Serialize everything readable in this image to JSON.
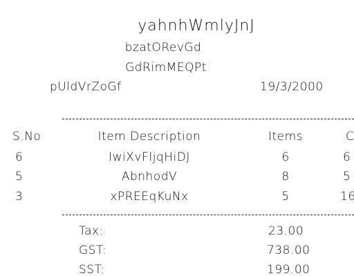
{
  "header": {
    "store_name": "yahnhWmlyJnJ",
    "line1": "bzatORevGd",
    "line2": "GdRimMEQPt",
    "receipt_code": "pUldVrZoGf",
    "date": "19/3/2000"
  },
  "table": {
    "columns": [
      "S.No",
      "Item Description",
      "Items",
      "C"
    ],
    "rows": [
      {
        "sno": "6",
        "description": "IwiXvFIjqHiDJ",
        "items": "6",
        "cost": "6"
      },
      {
        "sno": "5",
        "description": "AbnhodV",
        "items": "8",
        "cost": "5"
      },
      {
        "sno": "3",
        "description": "xPREEqKuNx",
        "items": "5",
        "cost": "16"
      }
    ]
  },
  "totals": [
    {
      "label": "Tax:",
      "value": "23.00"
    },
    {
      "label": "GST:",
      "value": "738.00"
    },
    {
      "label": "SST:",
      "value": "199.00"
    }
  ]
}
